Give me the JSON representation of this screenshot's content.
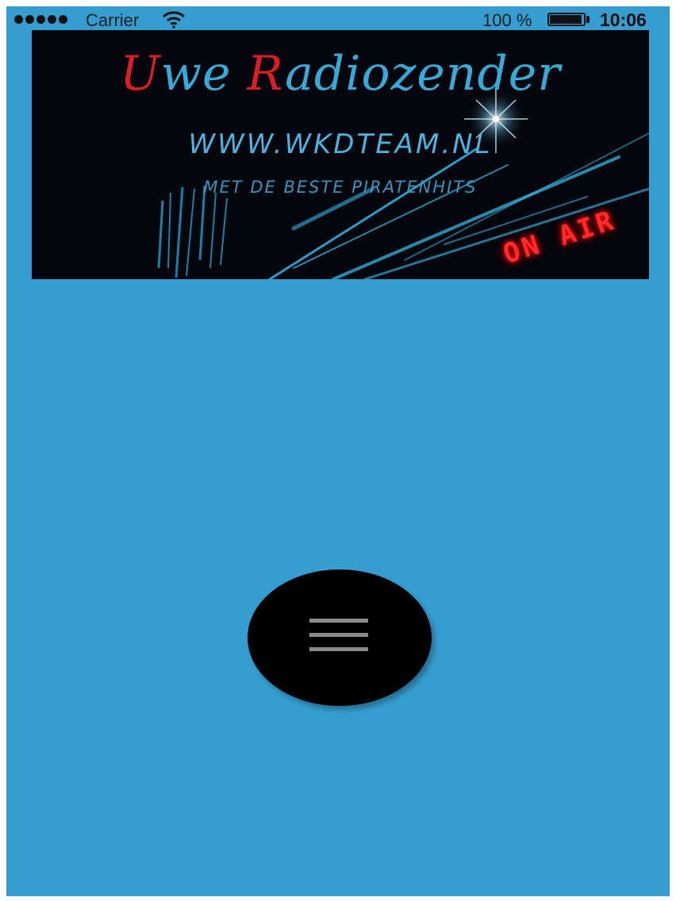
{
  "status_bar": {
    "carrier": "Carrier",
    "battery_percent": "100 %",
    "battery_level": 1.0,
    "time": "10:06",
    "signal_bars": 5
  },
  "banner": {
    "title_cap1": "U",
    "title_rest1": "we ",
    "title_cap2": "R",
    "title_rest2": "adiozender",
    "url": "WWW.WKDTEAM.NL",
    "tagline": "MET DE BESTE PIRATENHITS",
    "on_air": "ON AIR"
  },
  "menu_button": {
    "icon": "hamburger-menu-icon"
  },
  "colors": {
    "background": "#359dcf",
    "banner_background": "#03060c",
    "title_blue": "#39a9d8",
    "title_red": "#d81f26",
    "on_air_red": "#ff2b2b",
    "menu_button": "#000000",
    "menu_icon": "#8a8a8a"
  }
}
